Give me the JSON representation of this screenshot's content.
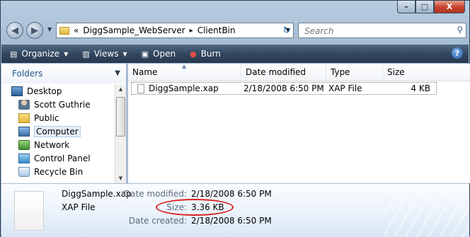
{
  "window": {
    "buttons": {
      "minimize": "–",
      "maximize": "□",
      "close": "X"
    }
  },
  "nav": {
    "back_glyph": "◀",
    "forward_glyph": "▶",
    "address": {
      "overflow": "«",
      "crumbs": [
        "DiggSample_WebServer",
        "ClientBin"
      ],
      "separator": "▸"
    },
    "refresh_glyph": "↻",
    "search": {
      "placeholder": "Search",
      "icon": "search-icon"
    }
  },
  "toolbar": {
    "items": [
      {
        "label": "Organize",
        "icon": "organize-icon",
        "dropdown": true
      },
      {
        "label": "Views",
        "icon": "views-icon",
        "dropdown": true
      },
      {
        "label": "Open",
        "icon": "open-icon",
        "dropdown": false
      },
      {
        "label": "Burn",
        "icon": "burn-icon",
        "dropdown": false
      }
    ],
    "help": "?"
  },
  "navpane": {
    "title": "Folders",
    "items": [
      {
        "label": "Desktop",
        "icon": "desktop-icon"
      },
      {
        "label": "Scott Guthrie",
        "icon": "user-folder-icon"
      },
      {
        "label": "Public",
        "icon": "folder-icon"
      },
      {
        "label": "Computer",
        "icon": "computer-icon",
        "selected": true
      },
      {
        "label": "Network",
        "icon": "network-icon"
      },
      {
        "label": "Control Panel",
        "icon": "control-panel-icon"
      },
      {
        "label": "Recycle Bin",
        "icon": "recycle-bin-icon"
      }
    ]
  },
  "files": {
    "columns": [
      "Name",
      "Date modified",
      "Type",
      "Size"
    ],
    "rows": [
      {
        "name": "DiggSample.xap",
        "date": "2/18/2008 6:50 PM",
        "type": "XAP File",
        "size": "4 KB"
      }
    ]
  },
  "details": {
    "name": "DiggSample.xap",
    "type": "XAP File",
    "date_modified_label": "Date modified:",
    "date_modified": "2/18/2008 6:50 PM",
    "size_label": "Size:",
    "size": "3.36 KB",
    "date_created_label": "Date created:",
    "date_created": "2/18/2008 6:50 PM",
    "highlight_color": "#d92020"
  }
}
